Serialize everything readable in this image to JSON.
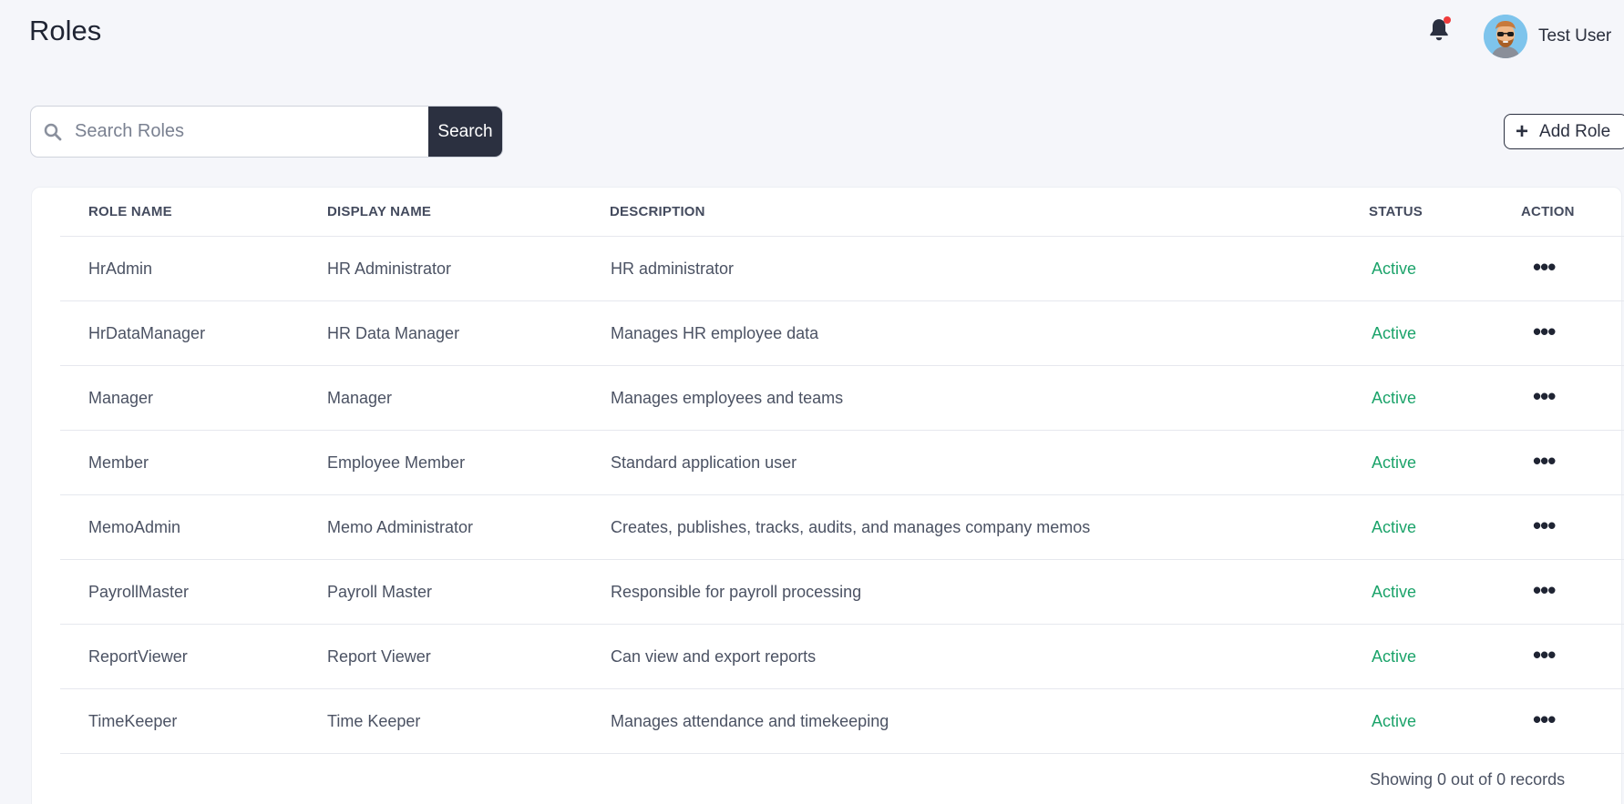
{
  "header": {
    "title": "Roles",
    "user_name": "Test User"
  },
  "toolbar": {
    "search_placeholder": "Search Roles",
    "search_value": "",
    "search_label": "Search",
    "add_role_label": "Add Role"
  },
  "table": {
    "columns": [
      "ROLE NAME",
      "DISPLAY NAME",
      "DESCRIPTION",
      "STATUS",
      "ACTION"
    ],
    "rows": [
      {
        "role": "HrAdmin",
        "display": "HR Administrator",
        "desc": "HR administrator",
        "status": "Active"
      },
      {
        "role": "HrDataManager",
        "display": "HR Data Manager",
        "desc": "Manages HR employee data",
        "status": "Active"
      },
      {
        "role": "Manager",
        "display": "Manager",
        "desc": "Manages employees and teams",
        "status": "Active"
      },
      {
        "role": "Member",
        "display": "Employee Member",
        "desc": "Standard application user",
        "status": "Active"
      },
      {
        "role": "MemoAdmin",
        "display": "Memo Administrator",
        "desc": "Creates, publishes, tracks, audits, and manages company memos",
        "status": "Active"
      },
      {
        "role": "PayrollMaster",
        "display": "Payroll Master",
        "desc": "Responsible for payroll processing",
        "status": "Active"
      },
      {
        "role": "ReportViewer",
        "display": "Report Viewer",
        "desc": "Can view and export reports",
        "status": "Active"
      },
      {
        "role": "TimeKeeper",
        "display": "Time Keeper",
        "desc": "Manages attendance and timekeeping",
        "status": "Active"
      }
    ],
    "action_glyph": "•••"
  },
  "footer": {
    "records_text": "Showing 0 out of 0 records"
  },
  "icons": {
    "bell": "bell-icon",
    "search": "search-icon",
    "plus": "plus-icon",
    "more": "more-horizontal-icon"
  },
  "colors": {
    "status_active": "#1ba36a",
    "notification_dot": "#ef3b3b",
    "primary_dark": "#2b3040"
  }
}
